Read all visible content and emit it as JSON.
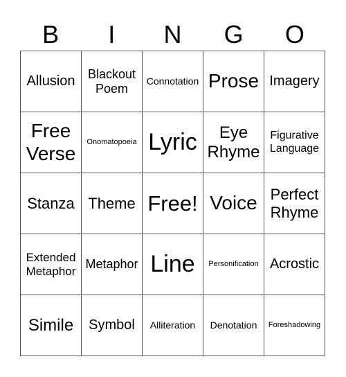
{
  "header": {
    "letters": [
      "B",
      "I",
      "N",
      "G",
      "O"
    ]
  },
  "cells": [
    [
      "Allusion",
      "Blackout Poem",
      "Connotation",
      "Prose",
      "Imagery"
    ],
    [
      "Free Verse",
      "Onomatopoeia",
      "Lyric",
      "Eye Rhyme",
      "Figurative Language"
    ],
    [
      "Stanza",
      "Theme",
      "Free!",
      "Voice",
      "Perfect Rhyme"
    ],
    [
      "Extended Metaphor",
      "Metaphor",
      "Line",
      "Personification",
      "Acrostic"
    ],
    [
      "Simile",
      "Symbol",
      "Alliteration",
      "Denotation",
      "Foreshadowing"
    ]
  ]
}
